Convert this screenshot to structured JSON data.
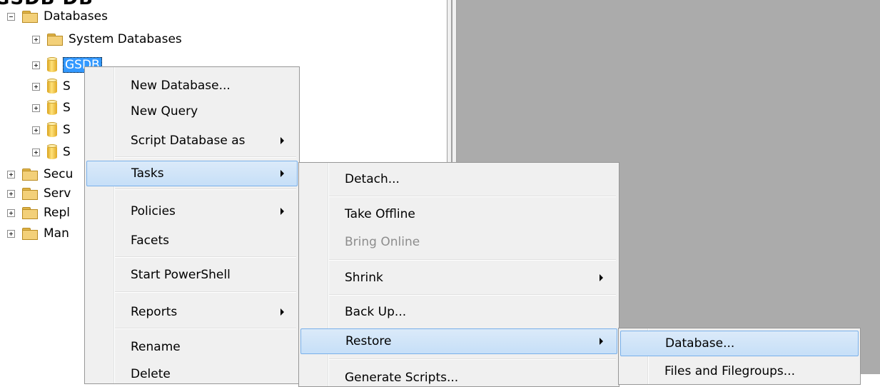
{
  "title_fragment": "GSDB DB",
  "tree": {
    "databases_label": "Databases",
    "system_databases_label": "System Databases",
    "selected_db_label": "GSDB",
    "db_rows": [
      "S",
      "S",
      "S",
      "S"
    ],
    "other_folders": [
      "Secu",
      "Serv",
      "Repl",
      "Man"
    ]
  },
  "context_menu": {
    "items": [
      "New Database...",
      "New Query",
      "Script Database as",
      "Tasks",
      "Policies",
      "Facets",
      "Start PowerShell",
      "Reports",
      "Rename",
      "Delete"
    ]
  },
  "tasks_menu": {
    "items": [
      "Detach...",
      "Take Offline",
      "Bring Online",
      "Shrink",
      "Back Up...",
      "Restore",
      "Generate Scripts..."
    ]
  },
  "restore_menu": {
    "items": [
      "Database...",
      "Files and Filegroups..."
    ]
  },
  "colors": {
    "selection": "#3399ff",
    "menu_background": "#f0f0f0",
    "highlight_border": "#79b0ea",
    "document_area": "#ababab"
  }
}
